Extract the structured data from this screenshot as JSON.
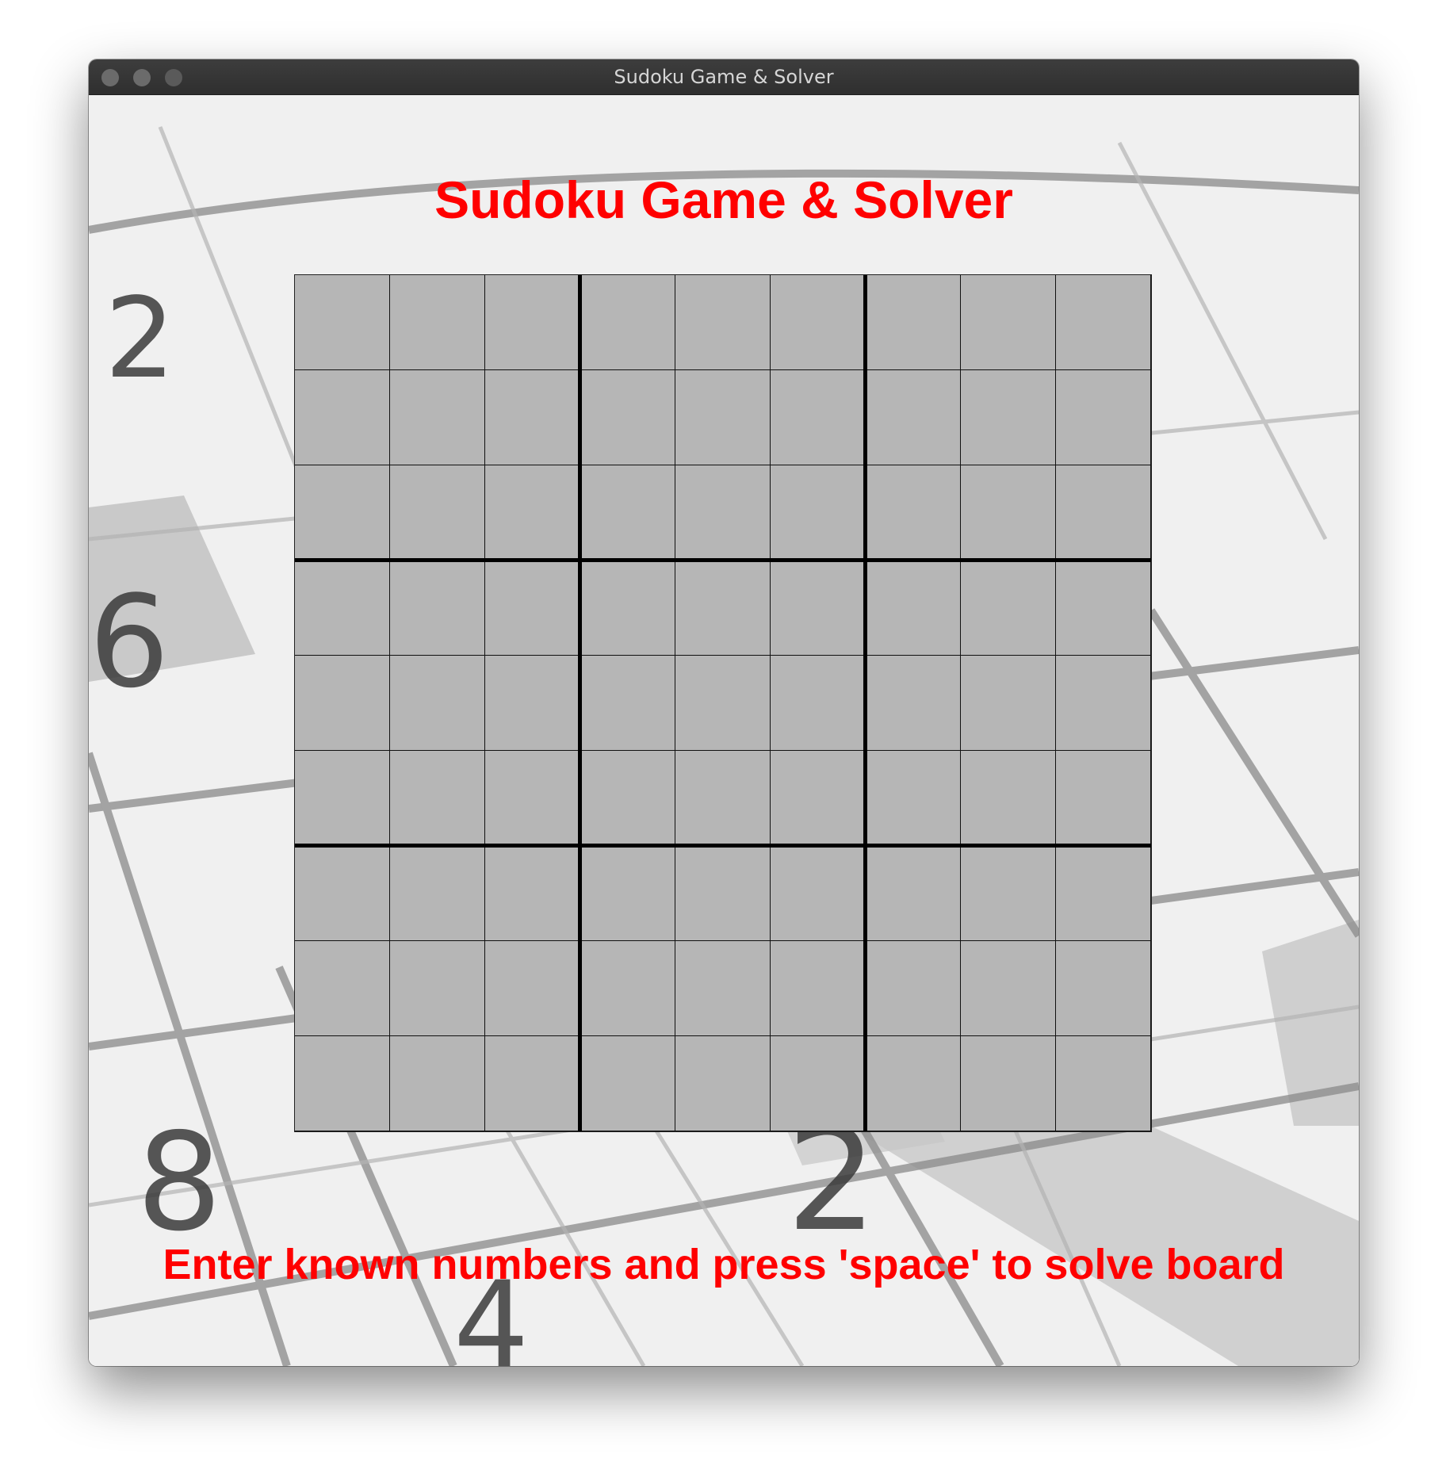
{
  "window": {
    "title": "Sudoku Game & Solver",
    "buttons": [
      "close",
      "minimize",
      "zoom"
    ]
  },
  "app": {
    "heading": "Sudoku Game & Solver",
    "instructions": "Enter known numbers and press 'space' to solve board",
    "accent_color": "#ff0000",
    "cell_color": "#b6b6b6"
  },
  "background_image": {
    "digits": [
      "2",
      "6",
      "8",
      "2",
      "4"
    ]
  },
  "board": {
    "size": 9,
    "cells": [
      [
        "",
        "",
        "",
        "",
        "",
        "",
        "",
        "",
        ""
      ],
      [
        "",
        "",
        "",
        "",
        "",
        "",
        "",
        "",
        ""
      ],
      [
        "",
        "",
        "",
        "",
        "",
        "",
        "",
        "",
        ""
      ],
      [
        "",
        "",
        "",
        "",
        "",
        "",
        "",
        "",
        ""
      ],
      [
        "",
        "",
        "",
        "",
        "",
        "",
        "",
        "",
        ""
      ],
      [
        "",
        "",
        "",
        "",
        "",
        "",
        "",
        "",
        ""
      ],
      [
        "",
        "",
        "",
        "",
        "",
        "",
        "",
        "",
        ""
      ],
      [
        "",
        "",
        "",
        "",
        "",
        "",
        "",
        "",
        ""
      ],
      [
        "",
        "",
        "",
        "",
        "",
        "",
        "",
        "",
        ""
      ]
    ]
  }
}
